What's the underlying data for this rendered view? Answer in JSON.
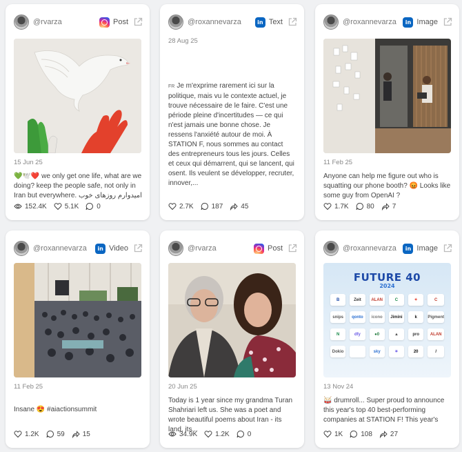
{
  "colors": {
    "background": "#f0f1f3",
    "instagram": "#d6249f",
    "linkedin": "#0a66c2"
  },
  "cards": [
    {
      "handle": "@rvarza",
      "platform": "instagram",
      "platform_icon": "instagram-icon",
      "type": "Post",
      "date": "15 Jun 25",
      "caption": "💚🕊️❤️ we only get one life, what are we doing? keep the people safe, not only in Iran but everywhere. امیدوارم روزهای خوب در",
      "stats": [
        {
          "icon": "eye-icon",
          "value": "152.4K"
        },
        {
          "icon": "heart-icon",
          "value": "5.1K"
        },
        {
          "icon": "comment-icon",
          "value": "0"
        }
      ]
    },
    {
      "handle": "@roxannevarza",
      "platform": "linkedin",
      "platform_icon": "linkedin-icon",
      "type": "Text",
      "date": "28 Aug 25",
      "lang_badge": "FR",
      "caption": "Je m'exprime rarement ici sur la politique, mais vu le contexte actuel, je trouve nécessaire de le faire. C'est une période pleine d'incertitudes — ce qui n'est jamais une bonne chose. Je ressens l'anxiété autour de moi. À STATION F, nous sommes au contact des entrepreneurs tous les jours. Celles et ceux qui démarrent, qui se lancent, qui osent. Ils veulent se développer, recruter, innover,...",
      "stats": [
        {
          "icon": "heart-icon",
          "value": "2.7K"
        },
        {
          "icon": "comment-icon",
          "value": "187"
        },
        {
          "icon": "share-icon",
          "value": "45"
        }
      ]
    },
    {
      "handle": "@roxannevarza",
      "platform": "linkedin",
      "platform_icon": "linkedin-icon",
      "type": "Image",
      "date": "11 Feb 25",
      "caption": "Anyone can help me figure out who is squatting our phone booth? 😡 Looks like some guy from OpenAI ?",
      "stats": [
        {
          "icon": "heart-icon",
          "value": "1.7K"
        },
        {
          "icon": "comment-icon",
          "value": "80"
        },
        {
          "icon": "share-icon",
          "value": "7"
        }
      ]
    },
    {
      "handle": "@roxannevarza",
      "platform": "linkedin",
      "platform_icon": "linkedin-icon",
      "type": "Video",
      "date": "11 Feb 25",
      "caption": "Insane 😍 #aiactionsummit",
      "stats": [
        {
          "icon": "heart-icon",
          "value": "1.2K"
        },
        {
          "icon": "comment-icon",
          "value": "59"
        },
        {
          "icon": "share-icon",
          "value": "15"
        }
      ]
    },
    {
      "handle": "@rvarza",
      "platform": "instagram",
      "platform_icon": "instagram-icon",
      "type": "Post",
      "date": "20 Jun 25",
      "caption": "Today is 1 year since my grandma Turan Shahriari left us. She was a poet and wrote beautiful poems about Iran - its land, its...",
      "stats": [
        {
          "icon": "eye-icon",
          "value": "34.9K"
        },
        {
          "icon": "heart-icon",
          "value": "1.2K"
        },
        {
          "icon": "comment-icon",
          "value": "0"
        }
      ]
    },
    {
      "handle": "@roxannevarza",
      "platform": "linkedin",
      "platform_icon": "linkedin-icon",
      "type": "Image",
      "date": "13 Nov 24",
      "caption": "🥁 drumroll... Super proud to announce this year's top 40 best-performing companies at STATION F! This year's Futur...",
      "stats": [
        {
          "icon": "heart-icon",
          "value": "1K"
        },
        {
          "icon": "comment-icon",
          "value": "108"
        },
        {
          "icon": "share-icon",
          "value": "27"
        }
      ]
    }
  ],
  "future40": {
    "title": "FUTURE 40",
    "year": "2024",
    "logos": [
      "B",
      "Zeit",
      "ALAN",
      "C",
      "✦",
      "C",
      "snips",
      "qonto",
      "icono",
      "Jimini",
      "k",
      "Pigment",
      "N",
      "dfy",
      "●0",
      "▲",
      "pro",
      "ALAN",
      "Dokio",
      "",
      "sky",
      "✶",
      "20",
      "/"
    ]
  }
}
